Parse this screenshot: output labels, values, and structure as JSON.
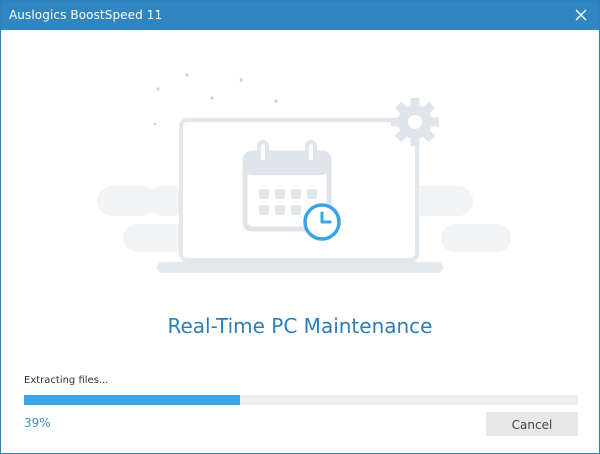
{
  "window": {
    "title": "Auslogics BoostSpeed 11",
    "accent_color": "#2f86c1"
  },
  "titlebar": {
    "close_icon": "close-icon"
  },
  "illustration": {
    "icons": [
      "laptop-icon",
      "calendar-icon",
      "clock-icon",
      "gear-icon",
      "sparkle-icon"
    ]
  },
  "main": {
    "heading": "Real-Time PC Maintenance"
  },
  "progress": {
    "status": "Extracting files...",
    "percent_label": "39%",
    "value": 0.39,
    "fill_color": "#3aa4e4"
  },
  "actions": {
    "cancel_label": "Cancel"
  }
}
